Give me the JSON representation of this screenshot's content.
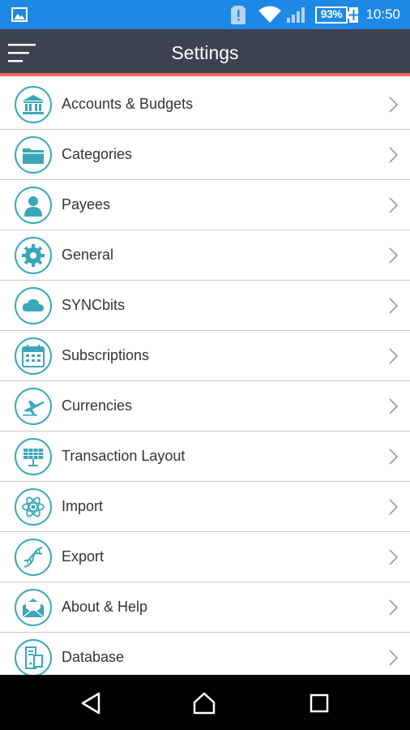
{
  "status_bar": {
    "battery_level": "93%",
    "time": "10:50",
    "icons": [
      "gallery-icon",
      "sim-alert-icon",
      "wifi-icon",
      "signal-icon",
      "battery-charging-icon"
    ]
  },
  "app_bar": {
    "title": "Settings",
    "menu_icon": "hamburger-menu-icon"
  },
  "colors": {
    "status_bar": "#1e88e5",
    "app_bar": "#3c4250",
    "accent_line": "#f06a5b",
    "icon_teal": "#3aa7b9"
  },
  "settings_items": [
    {
      "label": "Accounts & Budgets",
      "icon": "bank-icon"
    },
    {
      "label": "Categories",
      "icon": "folder-icon"
    },
    {
      "label": "Payees",
      "icon": "person-icon"
    },
    {
      "label": "General",
      "icon": "gear-icon"
    },
    {
      "label": "SYNCbits",
      "icon": "cloud-icon"
    },
    {
      "label": "Subscriptions",
      "icon": "calendar-icon"
    },
    {
      "label": "Currencies",
      "icon": "airplane-icon"
    },
    {
      "label": "Transaction Layout",
      "icon": "solar-panel-icon"
    },
    {
      "label": "Import",
      "icon": "atom-icon"
    },
    {
      "label": "Export",
      "icon": "dna-icon"
    },
    {
      "label": "About & Help",
      "icon": "envelope-icon"
    },
    {
      "label": "Database",
      "icon": "server-icon"
    }
  ],
  "nav_bar": {
    "icons": [
      "back-icon",
      "home-icon",
      "recent-apps-icon"
    ]
  }
}
